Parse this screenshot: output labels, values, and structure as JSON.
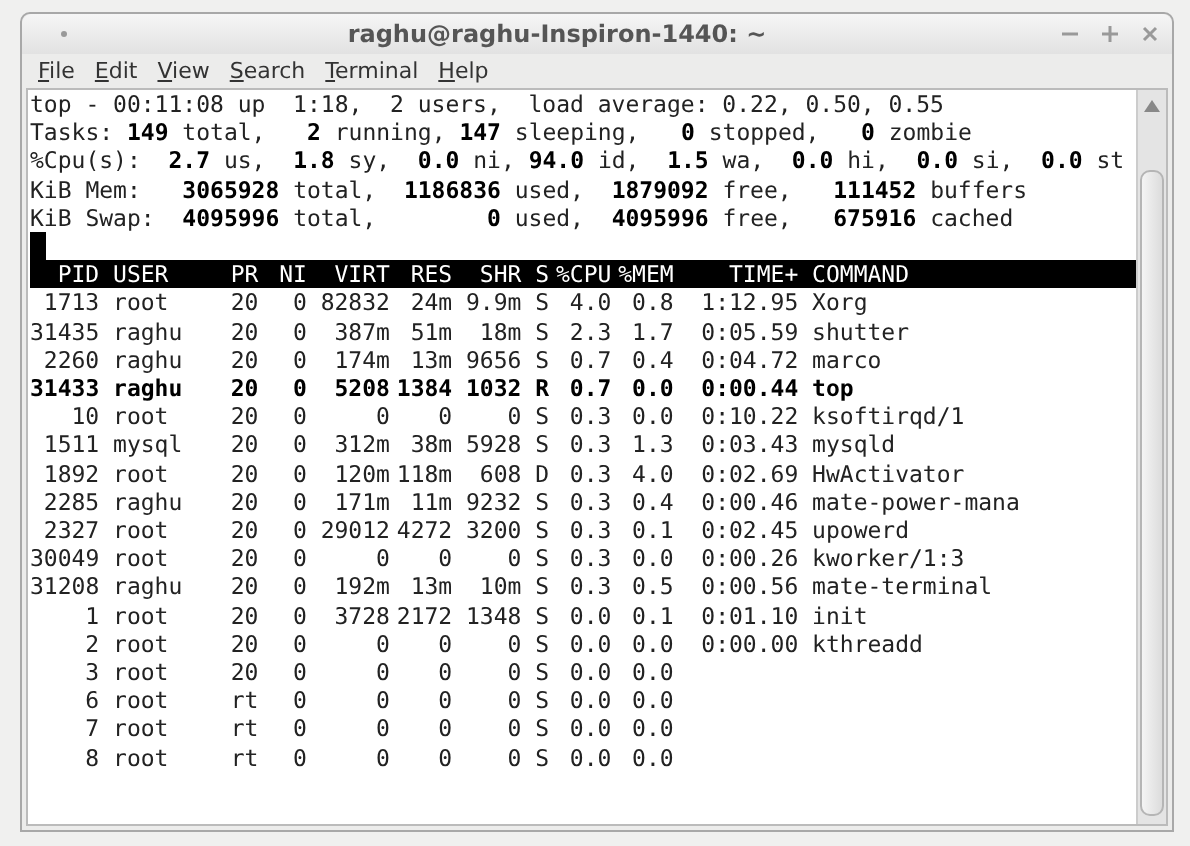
{
  "window": {
    "title": "raghu@raghu-Inspiron-1440: ~"
  },
  "menu": [
    {
      "accel": "F",
      "rest": "ile"
    },
    {
      "accel": "E",
      "rest": "dit"
    },
    {
      "accel": "V",
      "rest": "iew"
    },
    {
      "accel": "S",
      "rest": "earch"
    },
    {
      "accel": "T",
      "rest": "erminal"
    },
    {
      "accel": "H",
      "rest": "elp"
    }
  ],
  "summary": [
    "top - 00:11:08 up  1:18,  2 users,  load average: 0.22, 0.50, 0.55",
    "Tasks: **149** total,   **2** running, **147** sleeping,   **0** stopped,   **0** zombie",
    "%Cpu(s):  **2.7** us,  **1.8** sy,  **0.0** ni, **94.0** id,  **1.5** wa,  **0.0** hi,  **0.0** si,  **0.0** st",
    "KiB Mem:   **3065928** total,  **1186836** used,  **1879092** free,   **111452** buffers",
    "KiB Swap:  **4095996** total,        **0** used,  **4095996** free,   **675916** cached"
  ],
  "table": {
    "columns": [
      "PID",
      "USER",
      "PR",
      "NI",
      "VIRT",
      "RES",
      "SHR",
      "S",
      "%CPU",
      "%MEM",
      "TIME+",
      "COMMAND"
    ],
    "rows": [
      {
        "highlighted": false,
        "cells": [
          "1713",
          "root",
          "20",
          "0",
          "82832",
          "24m",
          "9.9m",
          "S",
          "4.0",
          "0.8",
          "1:12.95",
          "Xorg"
        ]
      },
      {
        "highlighted": false,
        "cells": [
          "31435",
          "raghu",
          "20",
          "0",
          "387m",
          "51m",
          "18m",
          "S",
          "2.3",
          "1.7",
          "0:05.59",
          "shutter"
        ]
      },
      {
        "highlighted": false,
        "cells": [
          "2260",
          "raghu",
          "20",
          "0",
          "174m",
          "13m",
          "9656",
          "S",
          "0.7",
          "0.4",
          "0:04.72",
          "marco"
        ]
      },
      {
        "highlighted": true,
        "cells": [
          "31433",
          "raghu",
          "20",
          "0",
          "5208",
          "1384",
          "1032",
          "R",
          "0.7",
          "0.0",
          "0:00.44",
          "top"
        ]
      },
      {
        "highlighted": false,
        "cells": [
          "10",
          "root",
          "20",
          "0",
          "0",
          "0",
          "0",
          "S",
          "0.3",
          "0.0",
          "0:10.22",
          "ksoftirqd/1"
        ]
      },
      {
        "highlighted": false,
        "cells": [
          "1511",
          "mysql",
          "20",
          "0",
          "312m",
          "38m",
          "5928",
          "S",
          "0.3",
          "1.3",
          "0:03.43",
          "mysqld"
        ]
      },
      {
        "highlighted": false,
        "cells": [
          "1892",
          "root",
          "20",
          "0",
          "120m",
          "118m",
          "608",
          "D",
          "0.3",
          "4.0",
          "0:02.69",
          "HwActivator"
        ]
      },
      {
        "highlighted": false,
        "cells": [
          "2285",
          "raghu",
          "20",
          "0",
          "171m",
          "11m",
          "9232",
          "S",
          "0.3",
          "0.4",
          "0:00.46",
          "mate-power-mana"
        ]
      },
      {
        "highlighted": false,
        "cells": [
          "2327",
          "root",
          "20",
          "0",
          "29012",
          "4272",
          "3200",
          "S",
          "0.3",
          "0.1",
          "0:02.45",
          "upowerd"
        ]
      },
      {
        "highlighted": false,
        "cells": [
          "30049",
          "root",
          "20",
          "0",
          "0",
          "0",
          "0",
          "S",
          "0.3",
          "0.0",
          "0:00.26",
          "kworker/1:3"
        ]
      },
      {
        "highlighted": false,
        "cells": [
          "31208",
          "raghu",
          "20",
          "0",
          "192m",
          "13m",
          "10m",
          "S",
          "0.3",
          "0.5",
          "0:00.56",
          "mate-terminal"
        ]
      },
      {
        "highlighted": false,
        "cells": [
          "1",
          "root",
          "20",
          "0",
          "3728",
          "2172",
          "1348",
          "S",
          "0.0",
          "0.1",
          "0:01.10",
          "init"
        ]
      },
      {
        "highlighted": false,
        "cells": [
          "2",
          "root",
          "20",
          "0",
          "0",
          "0",
          "0",
          "S",
          "0.0",
          "0.0",
          "0:00.00",
          "kthreadd"
        ]
      },
      {
        "highlighted": false,
        "cells": [
          "3",
          "root",
          "20",
          "0",
          "0",
          "0",
          "0",
          "S",
          "0.0",
          "0.0"
        ]
      },
      {
        "highlighted": false,
        "cells": [
          "6",
          "root",
          "rt",
          "0",
          "0",
          "0",
          "0",
          "S",
          "0.0",
          "0.0"
        ]
      },
      {
        "highlighted": false,
        "cells": [
          "7",
          "root",
          "rt",
          "0",
          "0",
          "0",
          "0",
          "S",
          "0.0",
          "0.0"
        ]
      },
      {
        "highlighted": false,
        "cells": [
          "8",
          "root",
          "rt",
          "0",
          "0",
          "0",
          "0",
          "S",
          "0.0",
          "0.0"
        ]
      }
    ]
  }
}
